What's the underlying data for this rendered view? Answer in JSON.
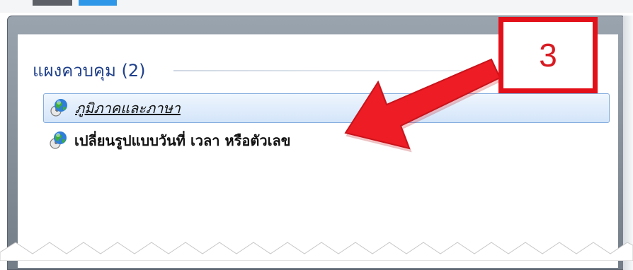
{
  "group": {
    "title": "แผงควบคุม (2)"
  },
  "items": [
    {
      "label": "ภูมิภาคและภาษา",
      "icon": "globe-clock-icon",
      "selected": true
    },
    {
      "label": "เปลี่ยนรูปแบบวันที่ เวลา หรือตัวเลข",
      "icon": "globe-clock-icon",
      "selected": false
    }
  ],
  "annotation": {
    "number": "3",
    "color": "#e3101a"
  },
  "colors": {
    "header_text": "#1e3f8a",
    "selection_border": "#84acdd",
    "selection_fill": "#d4e5fa"
  }
}
